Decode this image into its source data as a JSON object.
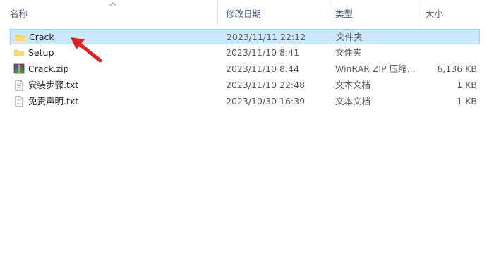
{
  "columns": {
    "name": "名称",
    "date": "修改日期",
    "type": "类型",
    "size": "大小"
  },
  "files": [
    {
      "name": "Crack",
      "date": "2023/11/11 22:12",
      "type": "文件夹",
      "size": "",
      "icon": "folder-icon",
      "selected": true
    },
    {
      "name": "Setup",
      "date": "2023/11/10 8:41",
      "type": "文件夹",
      "size": "",
      "icon": "folder-icon",
      "selected": false
    },
    {
      "name": "Crack.zip",
      "date": "2023/11/10 8:44",
      "type": "WinRAR ZIP 压缩...",
      "size": "6,136 KB",
      "icon": "winrar-archive-icon",
      "selected": false
    },
    {
      "name": "安装步骤.txt",
      "date": "2023/11/10 22:48",
      "type": "文本文档",
      "size": "1 KB",
      "icon": "text-file-icon",
      "selected": false
    },
    {
      "name": "免责声明.txt",
      "date": "2023/10/30 16:39",
      "type": "文本文档",
      "size": "1 KB",
      "icon": "text-file-icon",
      "selected": false
    }
  ],
  "colors": {
    "selection_bg": "#cce8ff",
    "selection_border": "#99d1ff",
    "header_text": "#4d6082",
    "annotation_arrow": "#e02020",
    "folder": "#f5c542"
  }
}
